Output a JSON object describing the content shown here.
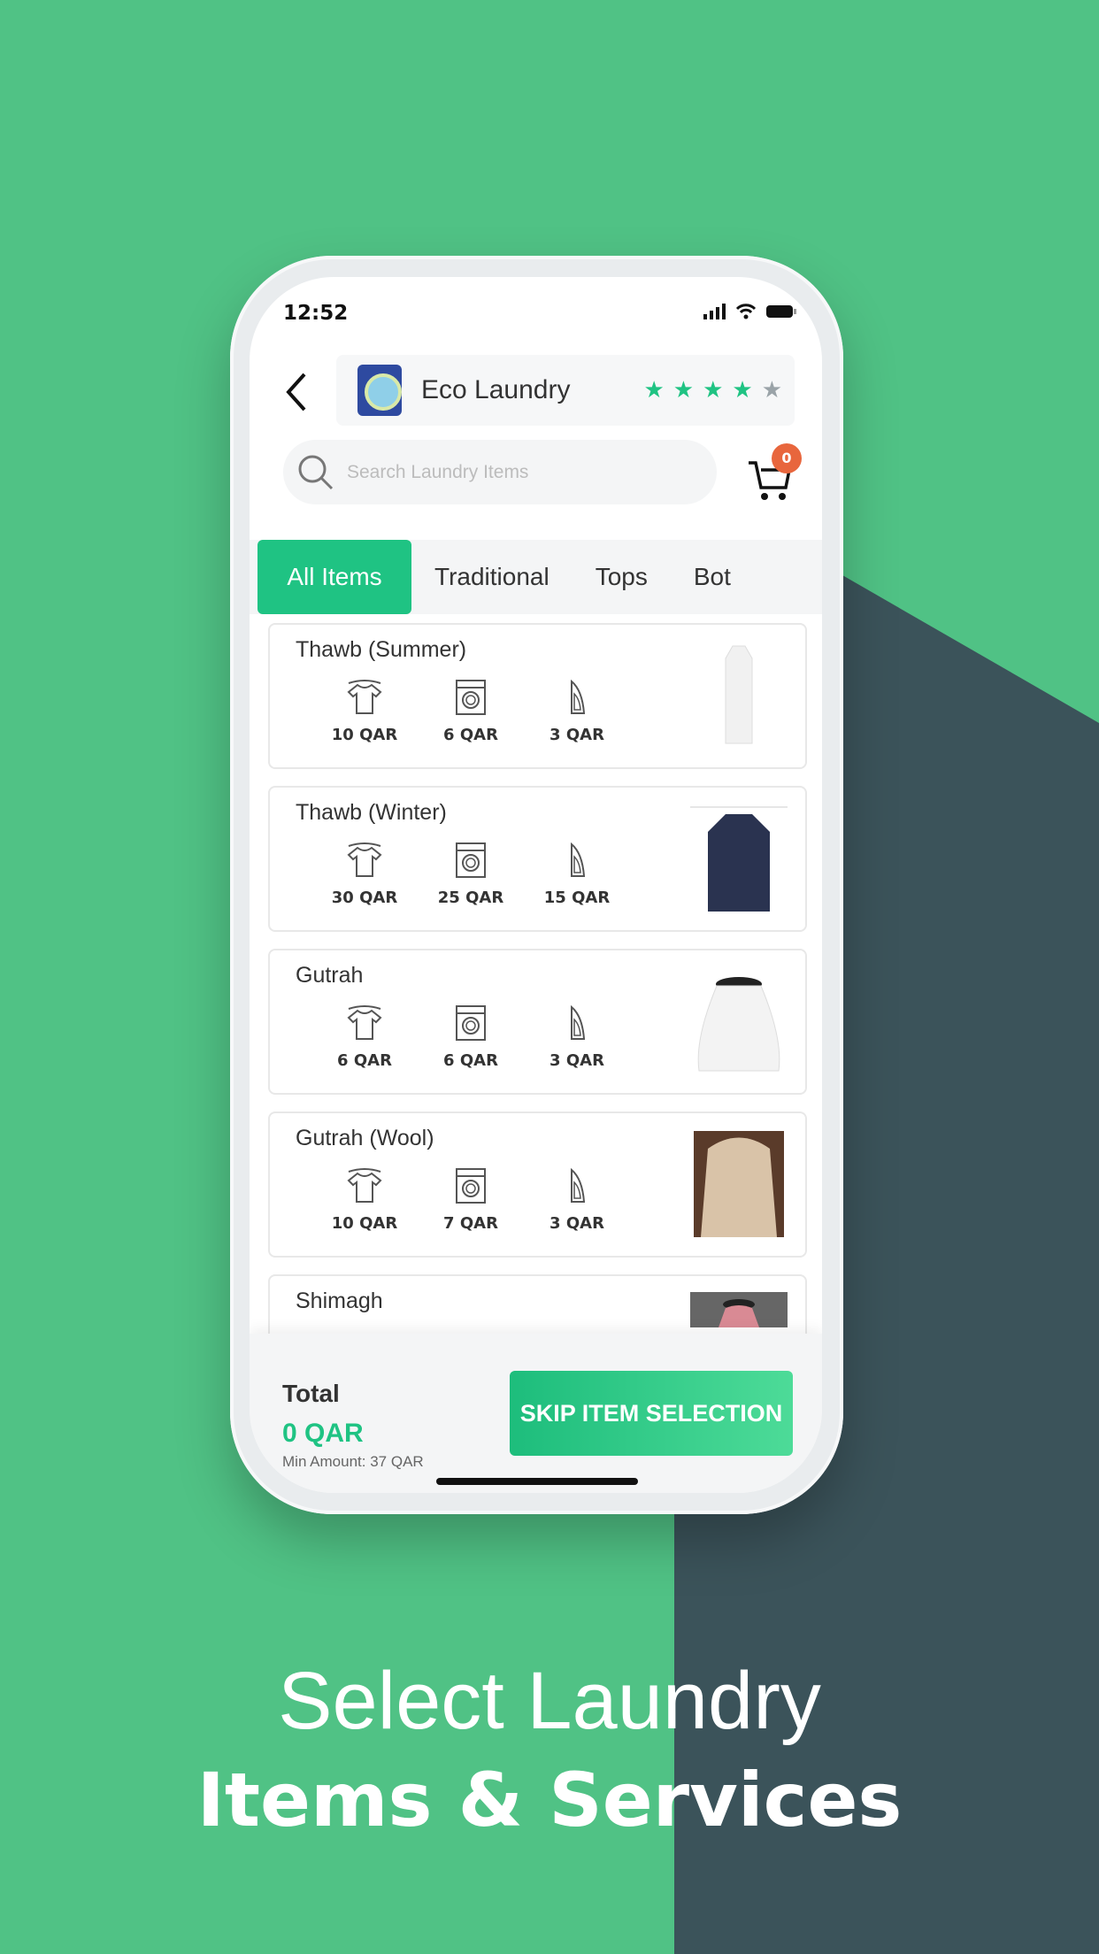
{
  "colors": {
    "background": "#50c285",
    "dark_panel": "#3b535a",
    "accent": "#1fc383",
    "badge": "#e8663d"
  },
  "status_bar": {
    "time": "12:52"
  },
  "header": {
    "shop_name": "Eco Laundry",
    "rating": 4,
    "rating_max": 5
  },
  "search": {
    "placeholder": "Search Laundry Items"
  },
  "cart": {
    "count": "0"
  },
  "tabs": [
    {
      "label": "All Items",
      "active": true
    },
    {
      "label": "Traditional"
    },
    {
      "label": "Tops"
    },
    {
      "label": "Bot"
    }
  ],
  "items": [
    {
      "name": "Thawb (Summer)",
      "prices": [
        "10 QAR",
        "6 QAR",
        "3 QAR"
      ],
      "image": "white-thawb"
    },
    {
      "name": "Thawb (Winter)",
      "prices": [
        "30 QAR",
        "25 QAR",
        "15 QAR"
      ],
      "image": "navy-thawb"
    },
    {
      "name": "Gutrah",
      "prices": [
        "6 QAR",
        "6 QAR",
        "3 QAR"
      ],
      "image": "white-gutrah"
    },
    {
      "name": "Gutrah (Wool)",
      "prices": [
        "10 QAR",
        "7 QAR",
        "3 QAR"
      ],
      "image": "wool-gutrah"
    },
    {
      "name": "Shimagh",
      "prices": [],
      "image": "shimagh"
    }
  ],
  "service_icons": [
    "shirt-hanger-icon",
    "washing-machine-icon",
    "iron-icon"
  ],
  "footer": {
    "total_label": "Total",
    "total_value": "0 QAR",
    "min_amount": "Min Amount: 37 QAR",
    "skip_button": "SKIP ITEM SELECTION"
  },
  "headline": {
    "line1": "Select Laundry",
    "line2": "Items & Services"
  }
}
